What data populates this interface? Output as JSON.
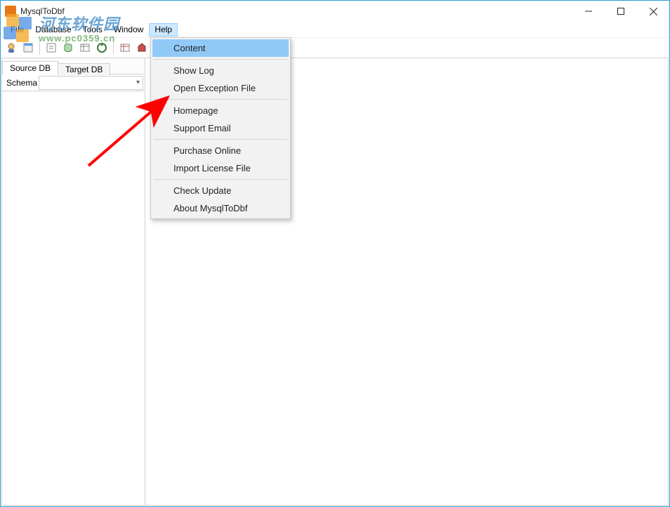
{
  "title": "MysqlToDbf",
  "menubar": [
    "File",
    "Database",
    "Tools",
    "Window",
    "Help"
  ],
  "open_menu_index": 4,
  "tabs": {
    "source": "Source DB",
    "target": "Target DB"
  },
  "schema_label": "Schema",
  "schema_value": "",
  "help_menu": {
    "items": [
      "Content",
      "Show Log",
      "Open Exception File",
      "Homepage",
      "Support Email",
      "Purchase Online",
      "Import License File",
      "Check Update",
      "About MysqlToDbf"
    ],
    "separators_after": [
      0,
      2,
      4,
      6
    ],
    "highlighted": 0
  },
  "watermark": {
    "text": "河东软件园",
    "url": "www.pc0359.cn"
  }
}
